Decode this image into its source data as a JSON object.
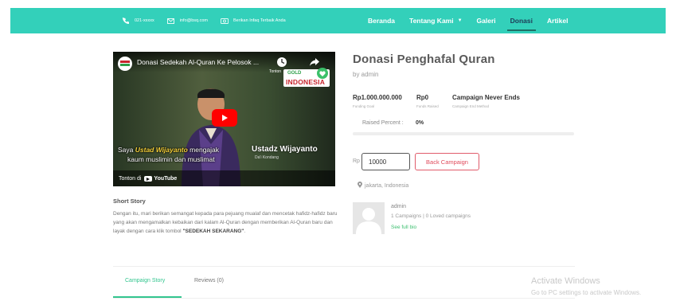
{
  "topbar": {
    "phone": "021-xxxxx",
    "email": "info@bsq.com",
    "tagline": "Berikan Infaq Terbaik Anda"
  },
  "nav": {
    "items": [
      {
        "label": "Beranda",
        "active": false
      },
      {
        "label": "Tentang Kami",
        "active": false,
        "has_caret": true
      },
      {
        "label": "Galeri",
        "active": false
      },
      {
        "label": "Donasi",
        "active": true
      },
      {
        "label": "Artikel",
        "active": false
      }
    ]
  },
  "video": {
    "title": "Donasi Sedekah Al-Quran Ke Pelosok ...",
    "tonton_small": "Tonton",
    "badge_line1": "GOLD",
    "badge_line2": "INDONESIA",
    "caption_pre": "Saya ",
    "caption_highlight": "Ustad Wijayanto",
    "caption_post": " mengajak",
    "caption_line2": "kaum muslimin dan muslimat",
    "ustadz_name": "Ustadz Wijayanto",
    "ustadz_sub": "Da'i Kondang",
    "tonton_di": "Tonton di",
    "youtube": "YouTube"
  },
  "story": {
    "heading": "Short Story",
    "text": "Dengan itu, mari berikan semangat kepada para pejuang mualaf dan mencetak hafidz-hafidz baru yang akan mengamalkan kebaikan dari kalam Al-Quran dengan memberikan Al-Quran baru dan layak dengan cara klik tombol ",
    "cta": "\"SEDEKAH SEKARANG\"",
    "end": "."
  },
  "campaign": {
    "title": "Donasi Penghafal Quran",
    "by": "by admin",
    "stats": [
      {
        "value": "Rp1.000.000.000",
        "label": "Funding Goal"
      },
      {
        "value": "Rp0",
        "label": "Funds Raised"
      },
      {
        "value": "Campaign Never Ends",
        "label": "Campaign End Method"
      }
    ],
    "raised_label": "Raised Percent :",
    "raised_value": "0%",
    "raised_fraction": 0,
    "currency": "Rp",
    "amount": "10000",
    "back_label": "Back Campaign",
    "location": "jakarta, Indonesia"
  },
  "author": {
    "name": "admin",
    "stats": "1 Campaigns | 0 Loved campaigns",
    "bio_link": "See full bio"
  },
  "tabs": [
    {
      "label": "Campaign Story",
      "active": true
    },
    {
      "label": "Reviews (0)",
      "active": false
    }
  ],
  "watermark": {
    "line1": "Activate Windows",
    "line2": "Go to PC settings to activate Windows."
  },
  "colors": {
    "accent": "#33d0ba",
    "active_nav": "#1f3b57",
    "button_border": "#e05c6b",
    "link_green": "#3cbf6f"
  }
}
